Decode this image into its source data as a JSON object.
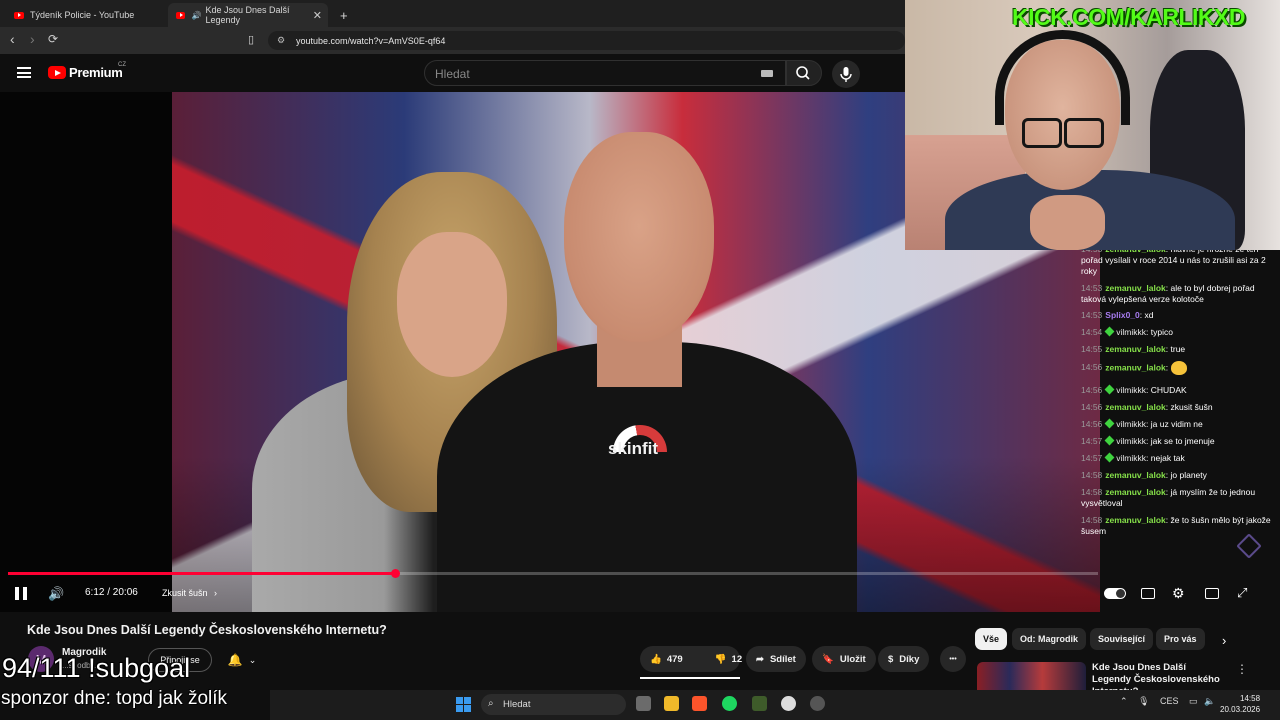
{
  "browser": {
    "tabs": [
      {
        "label": "Týdeník Policie - YouTube",
        "active": false
      },
      {
        "label": "Kde Jsou Dnes Další Legendy",
        "active": true
      }
    ],
    "new_tab": "+",
    "url": "youtube.com/watch?v=AmVS0E-qf64"
  },
  "youtube": {
    "logo_text": "Premium",
    "logo_region": "CZ",
    "search_placeholder": "Hledat"
  },
  "video": {
    "brand_text": "skinfit",
    "progress_fraction": 0.3548,
    "time": "6:12 / 20:06",
    "chapter": "Zkusit šušn",
    "chapter_arrow": "›"
  },
  "chat": {
    "messages": [
      {
        "time": "14:53",
        "user": "zemanuv_lalok",
        "text": "hlavně je hrozné že ten pořad vysílali v roce 2014 u nás to zrušili asi za 2 roky",
        "color": "green",
        "badge": false
      },
      {
        "time": "14:53",
        "user": "zemanuv_lalok",
        "text": "ale to byl dobrej pořad taková vylepšená verze kolotoče",
        "color": "green",
        "badge": false
      },
      {
        "time": "14:53",
        "user": "Splix0_0",
        "text": "xd",
        "color": "purple",
        "badge": false
      },
      {
        "time": "14:54",
        "user": "vilmikkk",
        "text": "typico",
        "color": "white",
        "badge": true
      },
      {
        "time": "14:55",
        "user": "zemanuv_lalok",
        "text": "true",
        "color": "green",
        "badge": false
      },
      {
        "time": "14:56",
        "user": "zemanuv_lalok",
        "text": "",
        "color": "green",
        "badge": false,
        "emote": true
      },
      {
        "time": "14:56",
        "user": "vilmikkk",
        "text": "CHUDAK",
        "color": "white",
        "badge": true
      },
      {
        "time": "14:56",
        "user": "zemanuv_lalok",
        "text": "zkusit šušn",
        "color": "green",
        "badge": false
      },
      {
        "time": "14:56",
        "user": "vilmikkk",
        "text": "ja uz vidim ne",
        "color": "white",
        "badge": true
      },
      {
        "time": "14:57",
        "user": "vilmikkk",
        "text": "jak se to jmenuje",
        "color": "white",
        "badge": true
      },
      {
        "time": "14:57",
        "user": "vilmikkk",
        "text": "nejak tak",
        "color": "white",
        "badge": true
      },
      {
        "time": "14:58",
        "user": "zemanuv_lalok",
        "text": "jo planety",
        "color": "green",
        "badge": false
      },
      {
        "time": "14:58",
        "user": "zemanuv_lalok",
        "text": "já myslím že to jednou vysvětloval",
        "color": "green",
        "badge": false
      },
      {
        "time": "14:58",
        "user": "zemanuv_lalok",
        "text": "že to šušn mělo být jakože šusem",
        "color": "green",
        "badge": false
      }
    ]
  },
  "watch": {
    "title": "Kde Jsou Dnes Další Legendy Československého Internetu?",
    "channel": "Magrodik",
    "channel_initial": "M",
    "subscribers": "...s. odb...",
    "join_label": "Připojit se",
    "likes": "479",
    "dislikes": "12",
    "share_label": "Sdílet",
    "save_label": "Uložit",
    "thanks_label": "Díky",
    "more_label": "•••"
  },
  "related": {
    "chips": [
      "Vše",
      "Od: Magrodik",
      "Související",
      "Pro vás"
    ],
    "active_chip": 0,
    "next_arrow": "›",
    "first_title": "Kde Jsou Dnes Další Legendy Československého Internetu?",
    "more": "⋮"
  },
  "stream_overlay": {
    "kick_url": "KICK.COM/KARLIKXD",
    "subgoal": "94/111 !subgoal",
    "sponsor": "sponzor dne: topd jak žolík"
  },
  "taskbar": {
    "search_label": "Hledat",
    "language": "CES",
    "time": "14:58",
    "date": "20.03.2026"
  },
  "colors": {
    "accent_red": "#ff0033",
    "kick_green": "#53fc18",
    "chat_user_green": "#86e04a",
    "chat_user_purple": "#a77cf0"
  }
}
